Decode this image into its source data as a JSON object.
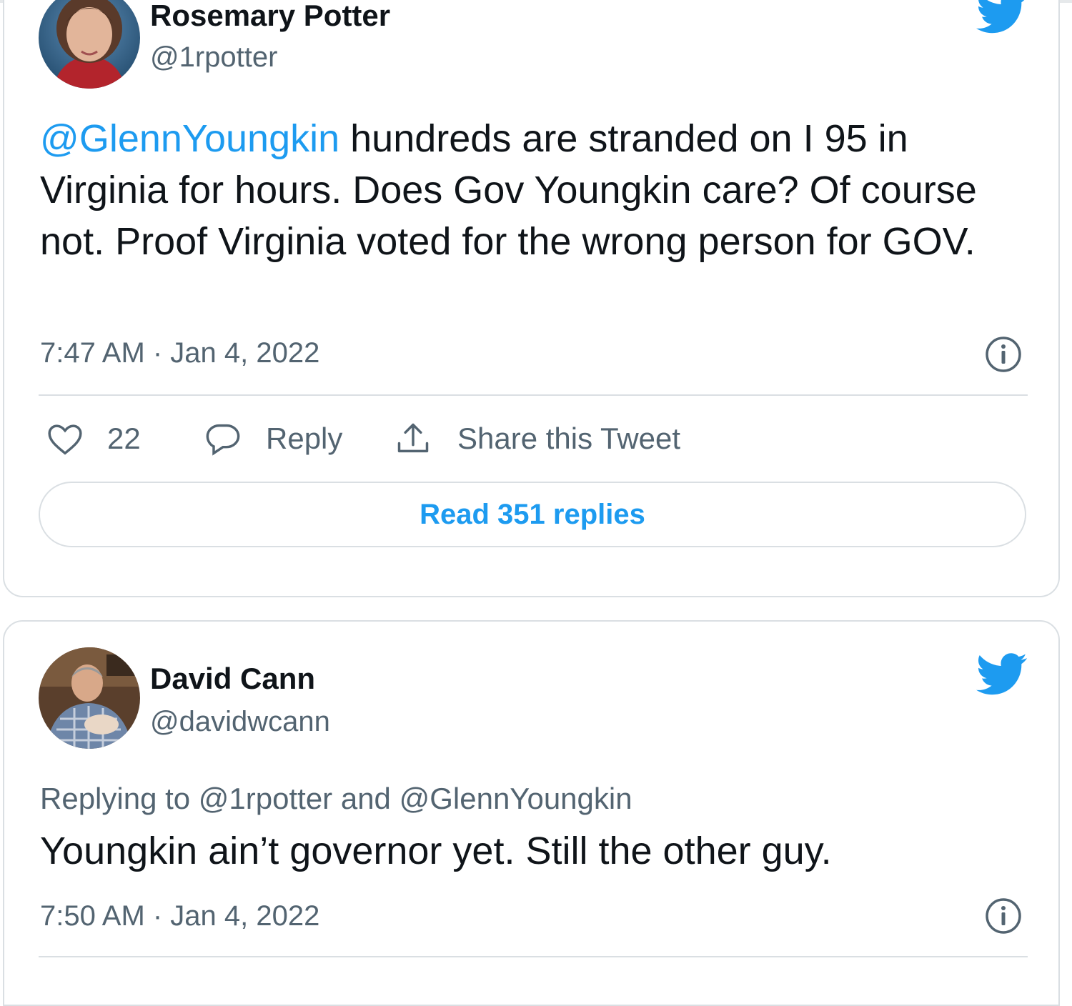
{
  "colors": {
    "accent": "#1d9bf0",
    "text": "#0f1419",
    "muted": "#536471",
    "border": "#dadfe3"
  },
  "tweet1": {
    "author_name": "Rosemary Potter",
    "handle": "@1rpotter",
    "mention": "@GlennYoungkin",
    "text": " hundreds are stranded on I 95 in Virginia for hours. Does Gov Youngkin care? Of course not. Proof Virginia voted for the wrong person for GOV.",
    "timestamp": "7:47 AM · Jan 4, 2022",
    "like_count": "22",
    "reply_label": "Reply",
    "share_label": "Share this Tweet",
    "read_replies_label": "Read 351 replies",
    "icons": [
      "twitter-bird-icon",
      "info-icon",
      "heart-icon",
      "reply-bubble-icon",
      "share-icon"
    ]
  },
  "tweet2": {
    "author_name": "David Cann",
    "handle": "@davidwcann",
    "replying_to": "Replying to @1rpotter and @GlennYoungkin",
    "text": "Youngkin ain’t governor yet. Still the other guy.",
    "timestamp": "7:50 AM · Jan 4, 2022",
    "icons": [
      "twitter-bird-icon",
      "info-icon"
    ]
  }
}
